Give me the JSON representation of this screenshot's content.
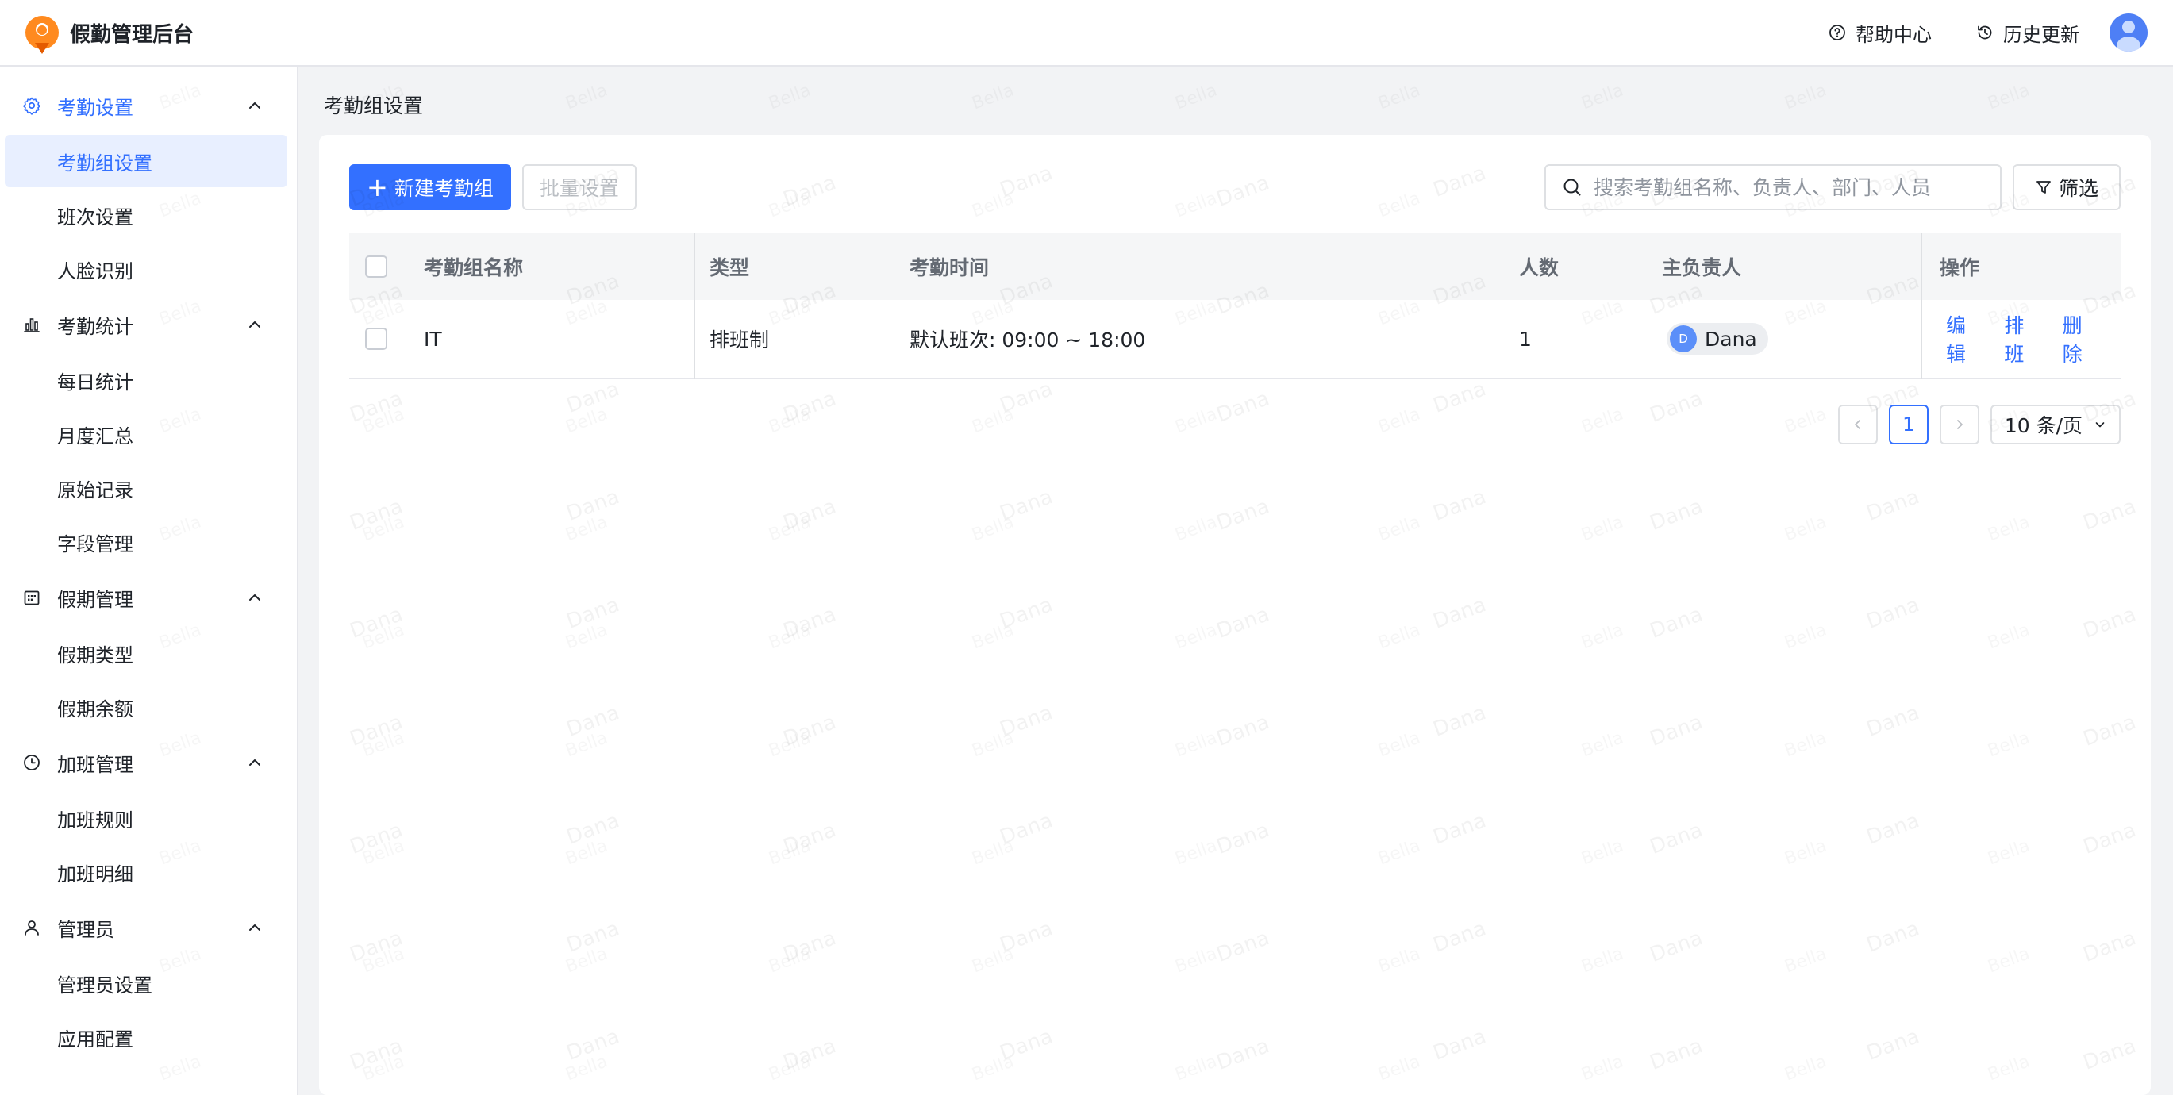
{
  "app": {
    "title": "假勤管理后台"
  },
  "header": {
    "help": "帮助中心",
    "history": "历史更新"
  },
  "sidebar": {
    "groups": [
      {
        "label": "考勤设置",
        "icon": "gear-icon",
        "items": [
          "考勤组设置",
          "班次设置",
          "人脸识别"
        ]
      },
      {
        "label": "考勤统计",
        "icon": "bar-chart-icon",
        "items": [
          "每日统计",
          "月度汇总",
          "原始记录",
          "字段管理"
        ]
      },
      {
        "label": "假期管理",
        "icon": "calendar-icon",
        "items": [
          "假期类型",
          "假期余额"
        ]
      },
      {
        "label": "加班管理",
        "icon": "clock-icon",
        "items": [
          "加班规则",
          "加班明细"
        ]
      },
      {
        "label": "管理员",
        "icon": "user-icon",
        "items": [
          "管理员设置",
          "应用配置"
        ]
      }
    ]
  },
  "page": {
    "title": "考勤组设置"
  },
  "toolbar": {
    "new_label": "新建考勤组",
    "batch_label": "批量设置",
    "search_placeholder": "搜索考勤组名称、负责人、部门、人员",
    "filter_label": "筛选"
  },
  "table": {
    "columns": [
      "考勤组名称",
      "类型",
      "考勤时间",
      "人数",
      "主负责人",
      "操作"
    ],
    "rows": [
      {
        "name": "IT",
        "type": "排班制",
        "time": "默认班次: 09:00 ~ 18:00",
        "count": "1",
        "owner": "Dana",
        "owner_initial": "D",
        "actions": [
          "编辑",
          "排班",
          "删除"
        ]
      }
    ]
  },
  "pagination": {
    "current": "1",
    "page_size": "10 条/页"
  },
  "watermark": {
    "primary": "Dana",
    "secondary": "Bella"
  },
  "colors": {
    "accent": "#3370ff",
    "logo": "#ff8a1f",
    "active_bg": "#e8efff"
  }
}
